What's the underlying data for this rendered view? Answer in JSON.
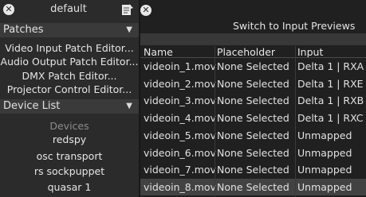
{
  "left_panel": {
    "title": "default",
    "patches": {
      "label": "Patches",
      "items": [
        "Video Input Patch Editor...",
        "Audio Output Patch Editor...",
        "DMX Patch Editor...",
        "Projector Control Editor..."
      ]
    },
    "device_list": {
      "label": "Device List",
      "group_label": "Devices",
      "items": [
        "redspy",
        "osc transport",
        "rs sockpuppet",
        "quasar 1"
      ]
    }
  },
  "right_panel": {
    "switch_label": "Switch to Input Previews",
    "columns": [
      "Name",
      "Placeholder",
      "Input"
    ],
    "rows": [
      {
        "name": "videoin_1.mov",
        "placeholder": "None Selected",
        "input": "Delta 1 | RXA"
      },
      {
        "name": "videoin_2.mov",
        "placeholder": "None Selected",
        "input": "Delta 1 | RXE"
      },
      {
        "name": "videoin_3.mov",
        "placeholder": "None Selected",
        "input": "Delta 1 | RXB"
      },
      {
        "name": "videoin_4.mov",
        "placeholder": "None Selected",
        "input": "Delta 1 | RXC"
      },
      {
        "name": "videoin_5.mov",
        "placeholder": "None Selected",
        "input": "Unmapped"
      },
      {
        "name": "videoin_6.mov",
        "placeholder": "None Selected",
        "input": "Unmapped"
      },
      {
        "name": "videoin_7.mov",
        "placeholder": "None Selected",
        "input": "Unmapped"
      },
      {
        "name": "videoin_8.mov",
        "placeholder": "None Selected",
        "input": "Unmapped",
        "selected": true
      }
    ]
  },
  "icons": {
    "close": "close-circle-icon",
    "edit": "edit-document-icon",
    "collapse": "triangle-down-icon"
  }
}
